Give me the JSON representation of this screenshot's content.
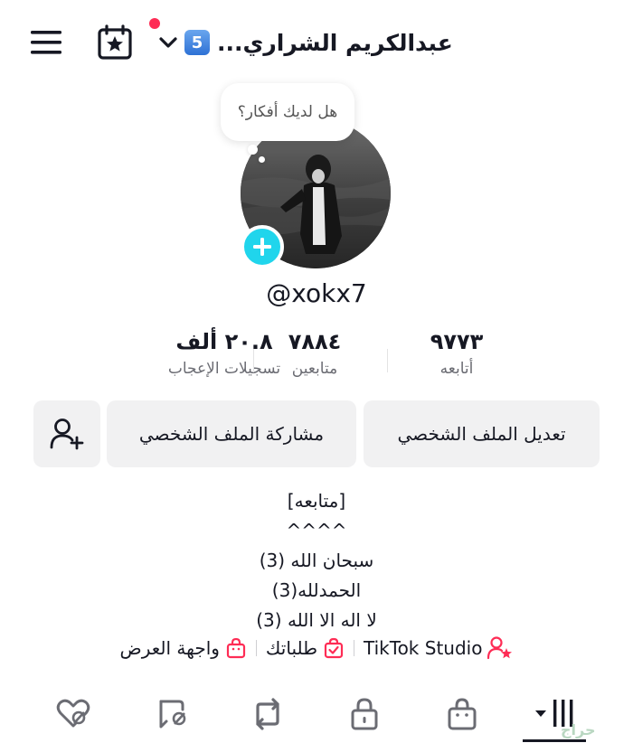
{
  "header": {
    "title": "عبدالكريم الشراري...",
    "badge_count": "5",
    "notification_color": "#fe2c55"
  },
  "profile": {
    "thought_bubble": "هل لديك أفكار؟",
    "handle": "@xokx7"
  },
  "stats": {
    "following": {
      "value": "٩٧٧٣",
      "label": "أتابعه"
    },
    "followers": {
      "value": "٧٨٨٤",
      "label": "متابعين"
    },
    "likes": {
      "value": "٢٠.٨ ألف",
      "label": "تسجيلات الإعجاب"
    }
  },
  "actions": {
    "edit_profile": "تعديل الملف الشخصي",
    "share_profile": "مشاركة الملف الشخصي"
  },
  "bio": {
    "lines": [
      "[متابعه]",
      "^^^^",
      "سبحان الله (3)",
      "الحمدلله(3)",
      "لا اله الا الله (3)"
    ]
  },
  "links": {
    "studio": "TikTok Studio",
    "orders": "طلباتك",
    "showcase": "واجهة العرض",
    "accent_color": "#fe2c55"
  },
  "tabs": {
    "icons": [
      "videos-grid-icon",
      "shop-icon",
      "private-lock-icon",
      "repost-icon",
      "favorites-icon",
      "liked-icon"
    ],
    "active": "videos-grid-icon"
  },
  "watermark": "حراج"
}
